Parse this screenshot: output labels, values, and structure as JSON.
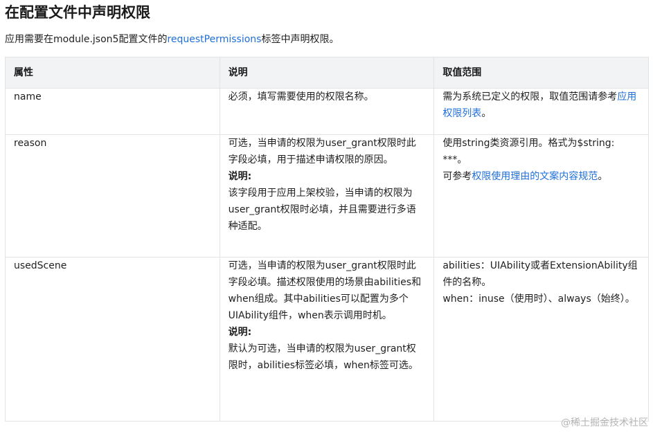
{
  "title": "在配置文件中声明权限",
  "intro": {
    "prefix": "应用需要在module.json5配置文件的",
    "link": "requestPermissions",
    "suffix": "标签中声明权限。"
  },
  "table": {
    "headers": [
      "属性",
      "说明",
      "取值范围"
    ],
    "rows": [
      {
        "attr": "name",
        "desc": "必须，填写需要使用的权限名称。",
        "range_prefix": "需为系统已定义的权限，取值范围请参考",
        "range_link": "应用权限列表",
        "range_suffix": "。"
      },
      {
        "attr": "reason",
        "desc": "可选，当申请的权限为user_grant权限时此字段必填，用于描述申请权限的原因。",
        "note_label": "说明:",
        "note": "该字段用于应用上架校验，当申请的权限为user_grant权限时必填，并且需要进行多语种适配。",
        "range_line1": "使用string类资源引用。格式为$string: ***。",
        "range_prefix": "可参考",
        "range_link": "权限使用理由的文案内容规范",
        "range_suffix": "。"
      },
      {
        "attr": "usedScene",
        "desc": "可选，当申请的权限为user_grant权限时此字段必填。描述权限使用的场景由abilities和when组成。其中abilities可以配置为多个UIAbility组件，when表示调用时机。",
        "note_label": "说明:",
        "note": "默认为可选，当申请的权限为user_grant权限时，abilities标签必填，when标签可选。",
        "range_line1": "abilities：UIAbility或者ExtensionAbility组件的名称。",
        "range_line2": "when：inuse（使用时）、always（始终）。"
      }
    ]
  },
  "watermark": "@稀土掘金技术社区"
}
